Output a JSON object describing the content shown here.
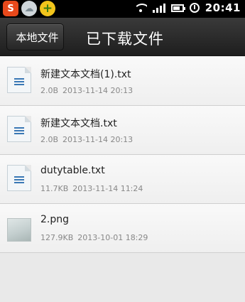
{
  "status_bar": {
    "apps": [
      {
        "icon": "s-input-app-icon",
        "glyph": "S"
      },
      {
        "icon": "cloud-app-icon",
        "glyph": "☁"
      },
      {
        "icon": "plus-app-icon",
        "glyph": "+"
      }
    ],
    "clock": "20:41"
  },
  "header": {
    "back_label": "本地文件",
    "title": "已下载文件"
  },
  "files": [
    {
      "name": "新建文本文档(1).txt",
      "size": "2.0B",
      "date": "2013-11-14 20:13",
      "type": "text"
    },
    {
      "name": "新建文本文档.txt",
      "size": "2.0B",
      "date": "2013-11-14 20:13",
      "type": "text"
    },
    {
      "name": "dutytable.txt",
      "size": "11.7KB",
      "date": "2013-11-14 11:24",
      "type": "text"
    },
    {
      "name": "2.png",
      "size": "127.9KB",
      "date": "2013-10-01 18:29",
      "type": "image"
    }
  ],
  "colors": {
    "accent_icon": "#3a78b5",
    "header_bg": "#2b2b2b",
    "list_bg": "#f4f4f4"
  }
}
